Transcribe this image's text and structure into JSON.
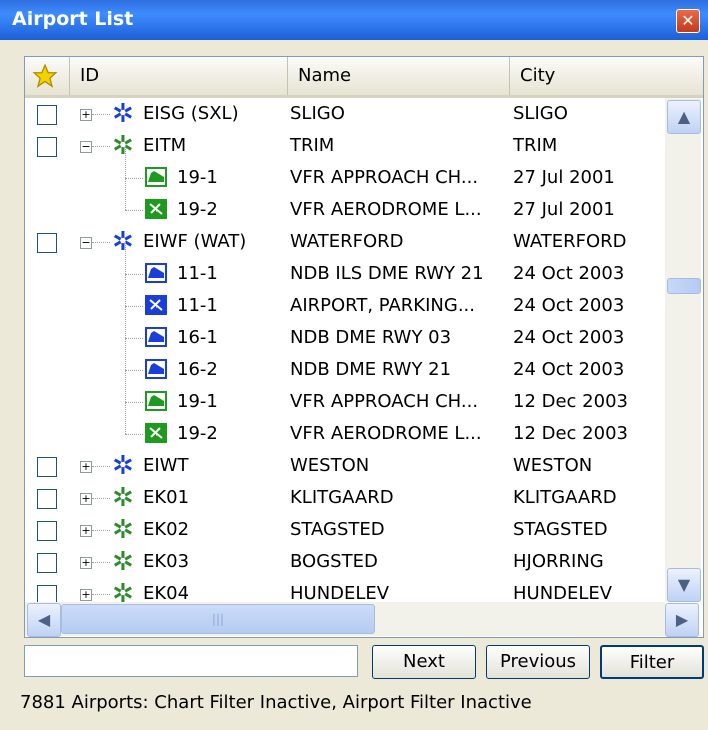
{
  "window": {
    "title": "Airport List",
    "close_label": "✕"
  },
  "columns": {
    "id": "ID",
    "name": "Name",
    "city": "City"
  },
  "rows": [
    {
      "type": "airport",
      "id": "EISG (SXL)",
      "name": "SLIGO",
      "city": "SLIGO",
      "expander": "+",
      "gear_color": "#1a3fd8"
    },
    {
      "type": "airport",
      "id": "EITM",
      "name": "TRIM",
      "city": "TRIM",
      "expander": "−",
      "gear_color": "#2e8b2e"
    },
    {
      "type": "chart",
      "id": "19-1",
      "name": "VFR APPROACH CH...",
      "city": "27 Jul 2001",
      "chart_color": "#1e9a1e",
      "chart_kind": "approach"
    },
    {
      "type": "chart",
      "id": "19-2",
      "name": "VFR AERODROME L...",
      "city": "27 Jul 2001",
      "chart_color": "#1e9a1e",
      "chart_kind": "aerodrome"
    },
    {
      "type": "airport",
      "id": "EIWF (WAT)",
      "name": "WATERFORD",
      "city": "WATERFORD",
      "expander": "−",
      "gear_color": "#1a3fd8"
    },
    {
      "type": "chart",
      "id": "11-1",
      "name": "NDB ILS DME RWY 21",
      "city": "24 Oct 2003",
      "chart_color": "#1a3fd8",
      "chart_kind": "approach"
    },
    {
      "type": "chart",
      "id": "11-1",
      "name": "AIRPORT, PARKING...",
      "city": "24 Oct 2003",
      "chart_color": "#1a3fd8",
      "chart_kind": "aerodrome"
    },
    {
      "type": "chart",
      "id": "16-1",
      "name": "NDB DME RWY 03",
      "city": "24 Oct 2003",
      "chart_color": "#1a3fd8",
      "chart_kind": "approach"
    },
    {
      "type": "chart",
      "id": "16-2",
      "name": "NDB DME RWY 21",
      "city": "24 Oct 2003",
      "chart_color": "#1a3fd8",
      "chart_kind": "approach"
    },
    {
      "type": "chart",
      "id": "19-1",
      "name": "VFR APPROACH CH...",
      "city": "12 Dec 2003",
      "chart_color": "#1e9a1e",
      "chart_kind": "approach"
    },
    {
      "type": "chart",
      "id": "19-2",
      "name": "VFR AERODROME L...",
      "city": "12 Dec 2003",
      "chart_color": "#1e9a1e",
      "chart_kind": "aerodrome"
    },
    {
      "type": "airport",
      "id": "EIWT",
      "name": "WESTON",
      "city": "WESTON",
      "expander": "+",
      "gear_color": "#1a3fd8"
    },
    {
      "type": "airport",
      "id": "EK01",
      "name": "KLITGAARD",
      "city": "KLITGAARD",
      "expander": "+",
      "gear_color": "#2e8b2e"
    },
    {
      "type": "airport",
      "id": "EK02",
      "name": "STAGSTED",
      "city": "STAGSTED",
      "expander": "+",
      "gear_color": "#2e8b2e"
    },
    {
      "type": "airport",
      "id": "EK03",
      "name": "BOGSTED",
      "city": "HJORRING",
      "expander": "+",
      "gear_color": "#2e8b2e"
    },
    {
      "type": "airport",
      "id": "EK04",
      "name": "HUNDELEV",
      "city": "HUNDELEV",
      "expander": "+",
      "gear_color": "#2e8b2e"
    }
  ],
  "scroll": {
    "up": "▲",
    "down": "▼",
    "left": "◀",
    "right": "▶",
    "grip": "|||"
  },
  "search": {
    "value": "",
    "placeholder": ""
  },
  "buttons": {
    "next": "Next",
    "previous": "Previous",
    "filter": "Filter"
  },
  "status": "7881 Airports: Chart Filter Inactive, Airport Filter Inactive",
  "colors": {
    "titlebar": "#2f6fe0",
    "favorite_star": "#f2d300"
  }
}
